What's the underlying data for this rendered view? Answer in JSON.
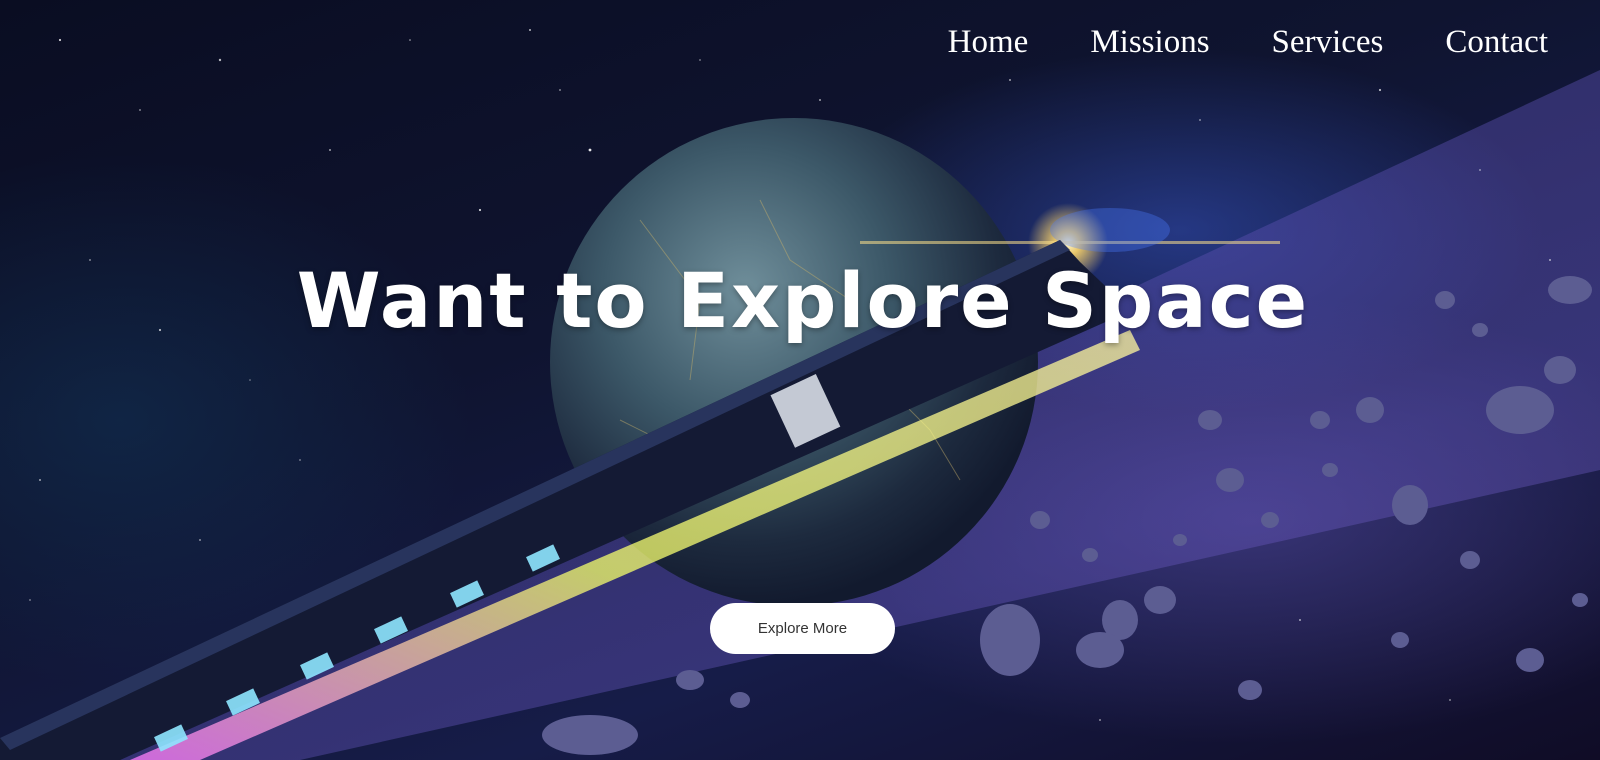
{
  "nav": {
    "items": [
      "Home",
      "Missions",
      "Services",
      "Contact"
    ]
  },
  "hero": {
    "headline": "Want to Explore Space",
    "cta_label": "Explore More"
  },
  "colors": {
    "text": "#ffffff",
    "button_bg": "#ffffff",
    "button_text": "#333333",
    "space_dark": "#0b0f24",
    "nebula_blue": "#466eff",
    "asteroid_purple": "#7a64d2"
  },
  "icons": [
    "planet-illustration",
    "space-train-illustration",
    "asteroid-field-illustration"
  ]
}
